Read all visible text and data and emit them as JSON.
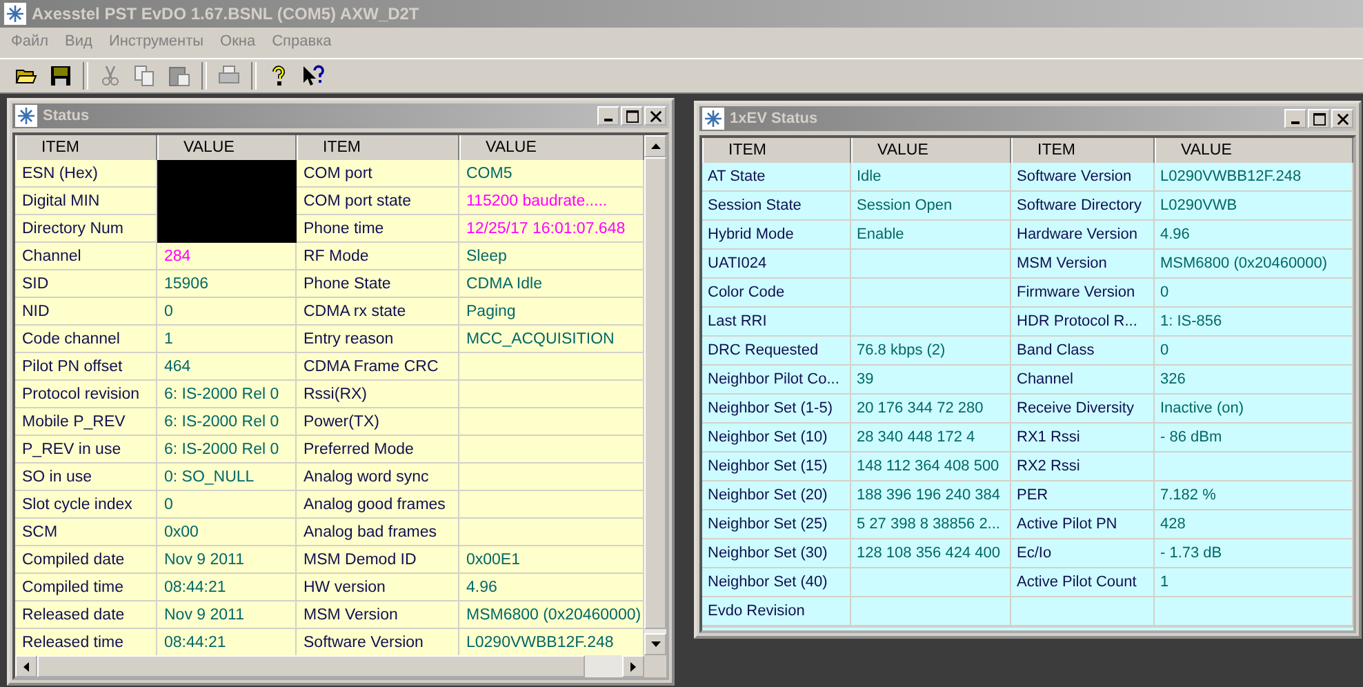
{
  "window": {
    "title": "Axesstel PST EvDO 1.67.BSNL (COM5) AXW_D2T"
  },
  "menu": [
    "Файл",
    "Вид",
    "Инструменты",
    "Окна",
    "Справка"
  ],
  "toolbar": [
    {
      "kind": "open"
    },
    {
      "kind": "save"
    },
    {
      "kind": "sep"
    },
    {
      "kind": "cut"
    },
    {
      "kind": "copy"
    },
    {
      "kind": "paste"
    },
    {
      "kind": "sep"
    },
    {
      "kind": "print"
    },
    {
      "kind": "sep"
    },
    {
      "kind": "help"
    },
    {
      "kind": "context-help"
    }
  ],
  "status_window": {
    "title": "Status",
    "columns": [
      "ITEM",
      "VALUE",
      "ITEM",
      "VALUE"
    ],
    "rows": [
      {
        "cells": [
          {
            "text": "ESN (Hex)",
            "kind": "item"
          },
          {
            "kind": "redacted"
          },
          {
            "text": "COM port",
            "kind": "item"
          },
          {
            "text": "COM5",
            "kind": "value"
          }
        ]
      },
      {
        "cells": [
          {
            "text": "Digital MIN",
            "kind": "item"
          },
          {
            "kind": "redacted"
          },
          {
            "text": "COM port state",
            "kind": "item"
          },
          {
            "text": "115200 baudrate.....",
            "kind": "alert"
          }
        ]
      },
      {
        "cells": [
          {
            "text": "Directory Num",
            "kind": "item"
          },
          {
            "kind": "redacted"
          },
          {
            "text": "Phone time",
            "kind": "item"
          },
          {
            "text": "12/25/17 16:01:07.648",
            "kind": "alert"
          }
        ]
      },
      {
        "cells": [
          {
            "text": "Channel",
            "kind": "item"
          },
          {
            "text": "284",
            "kind": "alert"
          },
          {
            "text": "RF Mode",
            "kind": "item"
          },
          {
            "text": "Sleep",
            "kind": "value"
          }
        ]
      },
      {
        "cells": [
          {
            "text": "SID",
            "kind": "item"
          },
          {
            "text": "15906",
            "kind": "value"
          },
          {
            "text": "Phone State",
            "kind": "item"
          },
          {
            "text": "CDMA Idle",
            "kind": "value"
          }
        ]
      },
      {
        "cells": [
          {
            "text": "NID",
            "kind": "item"
          },
          {
            "text": "0",
            "kind": "value"
          },
          {
            "text": "CDMA rx state",
            "kind": "item"
          },
          {
            "text": "Paging",
            "kind": "value"
          }
        ]
      },
      {
        "cells": [
          {
            "text": "Code channel",
            "kind": "item"
          },
          {
            "text": "1",
            "kind": "value"
          },
          {
            "text": "Entry reason",
            "kind": "item"
          },
          {
            "text": "MCC_ACQUISITION",
            "kind": "value"
          }
        ]
      },
      {
        "cells": [
          {
            "text": "Pilot PN offset",
            "kind": "item"
          },
          {
            "text": "464",
            "kind": "value"
          },
          {
            "text": "CDMA Frame CRC",
            "kind": "item"
          },
          {
            "kind": "value"
          }
        ]
      },
      {
        "cells": [
          {
            "text": "Protocol revision",
            "kind": "item"
          },
          {
            "text": "6:  IS-2000 Rel 0",
            "kind": "value"
          },
          {
            "text": "Rssi(RX)",
            "kind": "item"
          },
          {
            "kind": "value"
          }
        ]
      },
      {
        "cells": [
          {
            "text": "Mobile P_REV",
            "kind": "item"
          },
          {
            "text": "6:  IS-2000 Rel 0",
            "kind": "value"
          },
          {
            "text": "Power(TX)",
            "kind": "item"
          },
          {
            "kind": "value"
          }
        ]
      },
      {
        "cells": [
          {
            "text": "P_REV in use",
            "kind": "item"
          },
          {
            "text": "6:  IS-2000 Rel 0",
            "kind": "value"
          },
          {
            "text": "Preferred Mode",
            "kind": "item"
          },
          {
            "kind": "value"
          }
        ]
      },
      {
        "cells": [
          {
            "text": "SO in use",
            "kind": "item"
          },
          {
            "text": "0: SO_NULL",
            "kind": "value"
          },
          {
            "text": "Analog word sync",
            "kind": "item"
          },
          {
            "kind": "value"
          }
        ]
      },
      {
        "cells": [
          {
            "text": "Slot cycle index",
            "kind": "item"
          },
          {
            "text": "0",
            "kind": "value"
          },
          {
            "text": "Analog good frames",
            "kind": "item"
          },
          {
            "kind": "value"
          }
        ]
      },
      {
        "cells": [
          {
            "text": "SCM",
            "kind": "item"
          },
          {
            "text": "0x00",
            "kind": "value"
          },
          {
            "text": "Analog bad frames",
            "kind": "item"
          },
          {
            "kind": "value"
          }
        ]
      },
      {
        "cells": [
          {
            "text": "Compiled date",
            "kind": "item"
          },
          {
            "text": "Nov  9 2011",
            "kind": "value"
          },
          {
            "text": "MSM Demod ID",
            "kind": "item"
          },
          {
            "text": "0x00E1",
            "kind": "value"
          }
        ]
      },
      {
        "cells": [
          {
            "text": "Compiled time",
            "kind": "item"
          },
          {
            "text": "08:44:21",
            "kind": "value"
          },
          {
            "text": "HW version",
            "kind": "item"
          },
          {
            "text": "4.96",
            "kind": "value"
          }
        ]
      },
      {
        "cells": [
          {
            "text": "Released date",
            "kind": "item"
          },
          {
            "text": "Nov  9 2011",
            "kind": "value"
          },
          {
            "text": "MSM Version",
            "kind": "item"
          },
          {
            "text": "MSM6800 (0x20460000)",
            "kind": "value"
          }
        ]
      },
      {
        "cells": [
          {
            "text": "Released time",
            "kind": "item"
          },
          {
            "text": "08:44:21",
            "kind": "value"
          },
          {
            "text": "Software Version",
            "kind": "item"
          },
          {
            "text": "L0290VWBB12F.248",
            "kind": "value"
          }
        ]
      }
    ]
  },
  "evdo_window": {
    "title": "1xEV Status",
    "columns": [
      "ITEM",
      "VALUE",
      "ITEM",
      "VALUE"
    ],
    "rows": [
      {
        "cells": [
          {
            "text": "AT State",
            "kind": "item"
          },
          {
            "text": "Idle",
            "kind": "value"
          },
          {
            "text": "Software Version",
            "kind": "item"
          },
          {
            "text": "L0290VWBB12F.248",
            "kind": "value"
          }
        ]
      },
      {
        "cells": [
          {
            "text": "Session State",
            "kind": "item"
          },
          {
            "text": "Session Open",
            "kind": "value"
          },
          {
            "text": "Software Directory",
            "kind": "item"
          },
          {
            "text": "L0290VWB",
            "kind": "value"
          }
        ]
      },
      {
        "cells": [
          {
            "text": "Hybrid Mode",
            "kind": "item"
          },
          {
            "text": "Enable",
            "kind": "value"
          },
          {
            "text": "Hardware Version",
            "kind": "item"
          },
          {
            "text": "4.96",
            "kind": "value"
          }
        ]
      },
      {
        "cells": [
          {
            "text": "UATI024",
            "kind": "item"
          },
          {
            "kind": "value"
          },
          {
            "text": "MSM Version",
            "kind": "item"
          },
          {
            "text": "MSM6800 (0x20460000)",
            "kind": "value"
          }
        ]
      },
      {
        "cells": [
          {
            "text": "Color Code",
            "kind": "item"
          },
          {
            "kind": "value"
          },
          {
            "text": "Firmware Version",
            "kind": "item"
          },
          {
            "text": "0",
            "kind": "value"
          }
        ]
      },
      {
        "cells": [
          {
            "text": "Last RRI",
            "kind": "item"
          },
          {
            "kind": "value"
          },
          {
            "text": "HDR Protocol R...",
            "kind": "item"
          },
          {
            "text": "1: IS-856",
            "kind": "value"
          }
        ]
      },
      {
        "cells": [
          {
            "text": "DRC Requested",
            "kind": "item"
          },
          {
            "text": "76.8 kbps (2)",
            "kind": "value"
          },
          {
            "text": "Band Class",
            "kind": "item"
          },
          {
            "text": "0",
            "kind": "value"
          }
        ]
      },
      {
        "cells": [
          {
            "text": "Neighbor Pilot Co...",
            "kind": "item"
          },
          {
            "text": "39",
            "kind": "value"
          },
          {
            "text": "Channel",
            "kind": "item"
          },
          {
            "text": "326",
            "kind": "value"
          }
        ]
      },
      {
        "cells": [
          {
            "text": "Neighbor Set (1-5)",
            "kind": "item"
          },
          {
            "text": "20 176 344 72 280",
            "kind": "value"
          },
          {
            "text": "Receive Diversity",
            "kind": "item"
          },
          {
            "text": "Inactive (on)",
            "kind": "value"
          }
        ]
      },
      {
        "cells": [
          {
            "text": "Neighbor Set (10)",
            "kind": "item"
          },
          {
            "text": "28 340 448 172 4",
            "kind": "value"
          },
          {
            "text": "RX1 Rssi",
            "kind": "item"
          },
          {
            "text": "- 86 dBm",
            "kind": "value"
          }
        ]
      },
      {
        "cells": [
          {
            "text": "Neighbor Set (15)",
            "kind": "item"
          },
          {
            "text": "148 112 364 408 500",
            "kind": "value"
          },
          {
            "text": "RX2 Rssi",
            "kind": "item"
          },
          {
            "kind": "value"
          }
        ]
      },
      {
        "cells": [
          {
            "text": "Neighbor Set (20)",
            "kind": "item"
          },
          {
            "text": "188 396 196 240 384",
            "kind": "value"
          },
          {
            "text": "PER",
            "kind": "item"
          },
          {
            "text": "7.182 %",
            "kind": "value"
          }
        ]
      },
      {
        "cells": [
          {
            "text": "Neighbor Set (25)",
            "kind": "item"
          },
          {
            "text": "5 27 398 8 38856 2...",
            "kind": "value"
          },
          {
            "text": "Active Pilot PN",
            "kind": "item"
          },
          {
            "text": "428",
            "kind": "value"
          }
        ]
      },
      {
        "cells": [
          {
            "text": "Neighbor Set (30)",
            "kind": "item"
          },
          {
            "text": "128 108 356 424 400",
            "kind": "value"
          },
          {
            "text": "Ec/Io",
            "kind": "item"
          },
          {
            "text": "- 1.73 dB",
            "kind": "value"
          }
        ]
      },
      {
        "cells": [
          {
            "text": "Neighbor Set (40)",
            "kind": "item"
          },
          {
            "kind": "value"
          },
          {
            "text": "Active Pilot Count",
            "kind": "item"
          },
          {
            "text": "1",
            "kind": "value"
          }
        ]
      },
      {
        "cells": [
          {
            "text": "Evdo Revision",
            "kind": "item"
          },
          {
            "kind": "value"
          },
          {
            "kind": "item"
          },
          {
            "kind": "value"
          }
        ]
      }
    ]
  }
}
